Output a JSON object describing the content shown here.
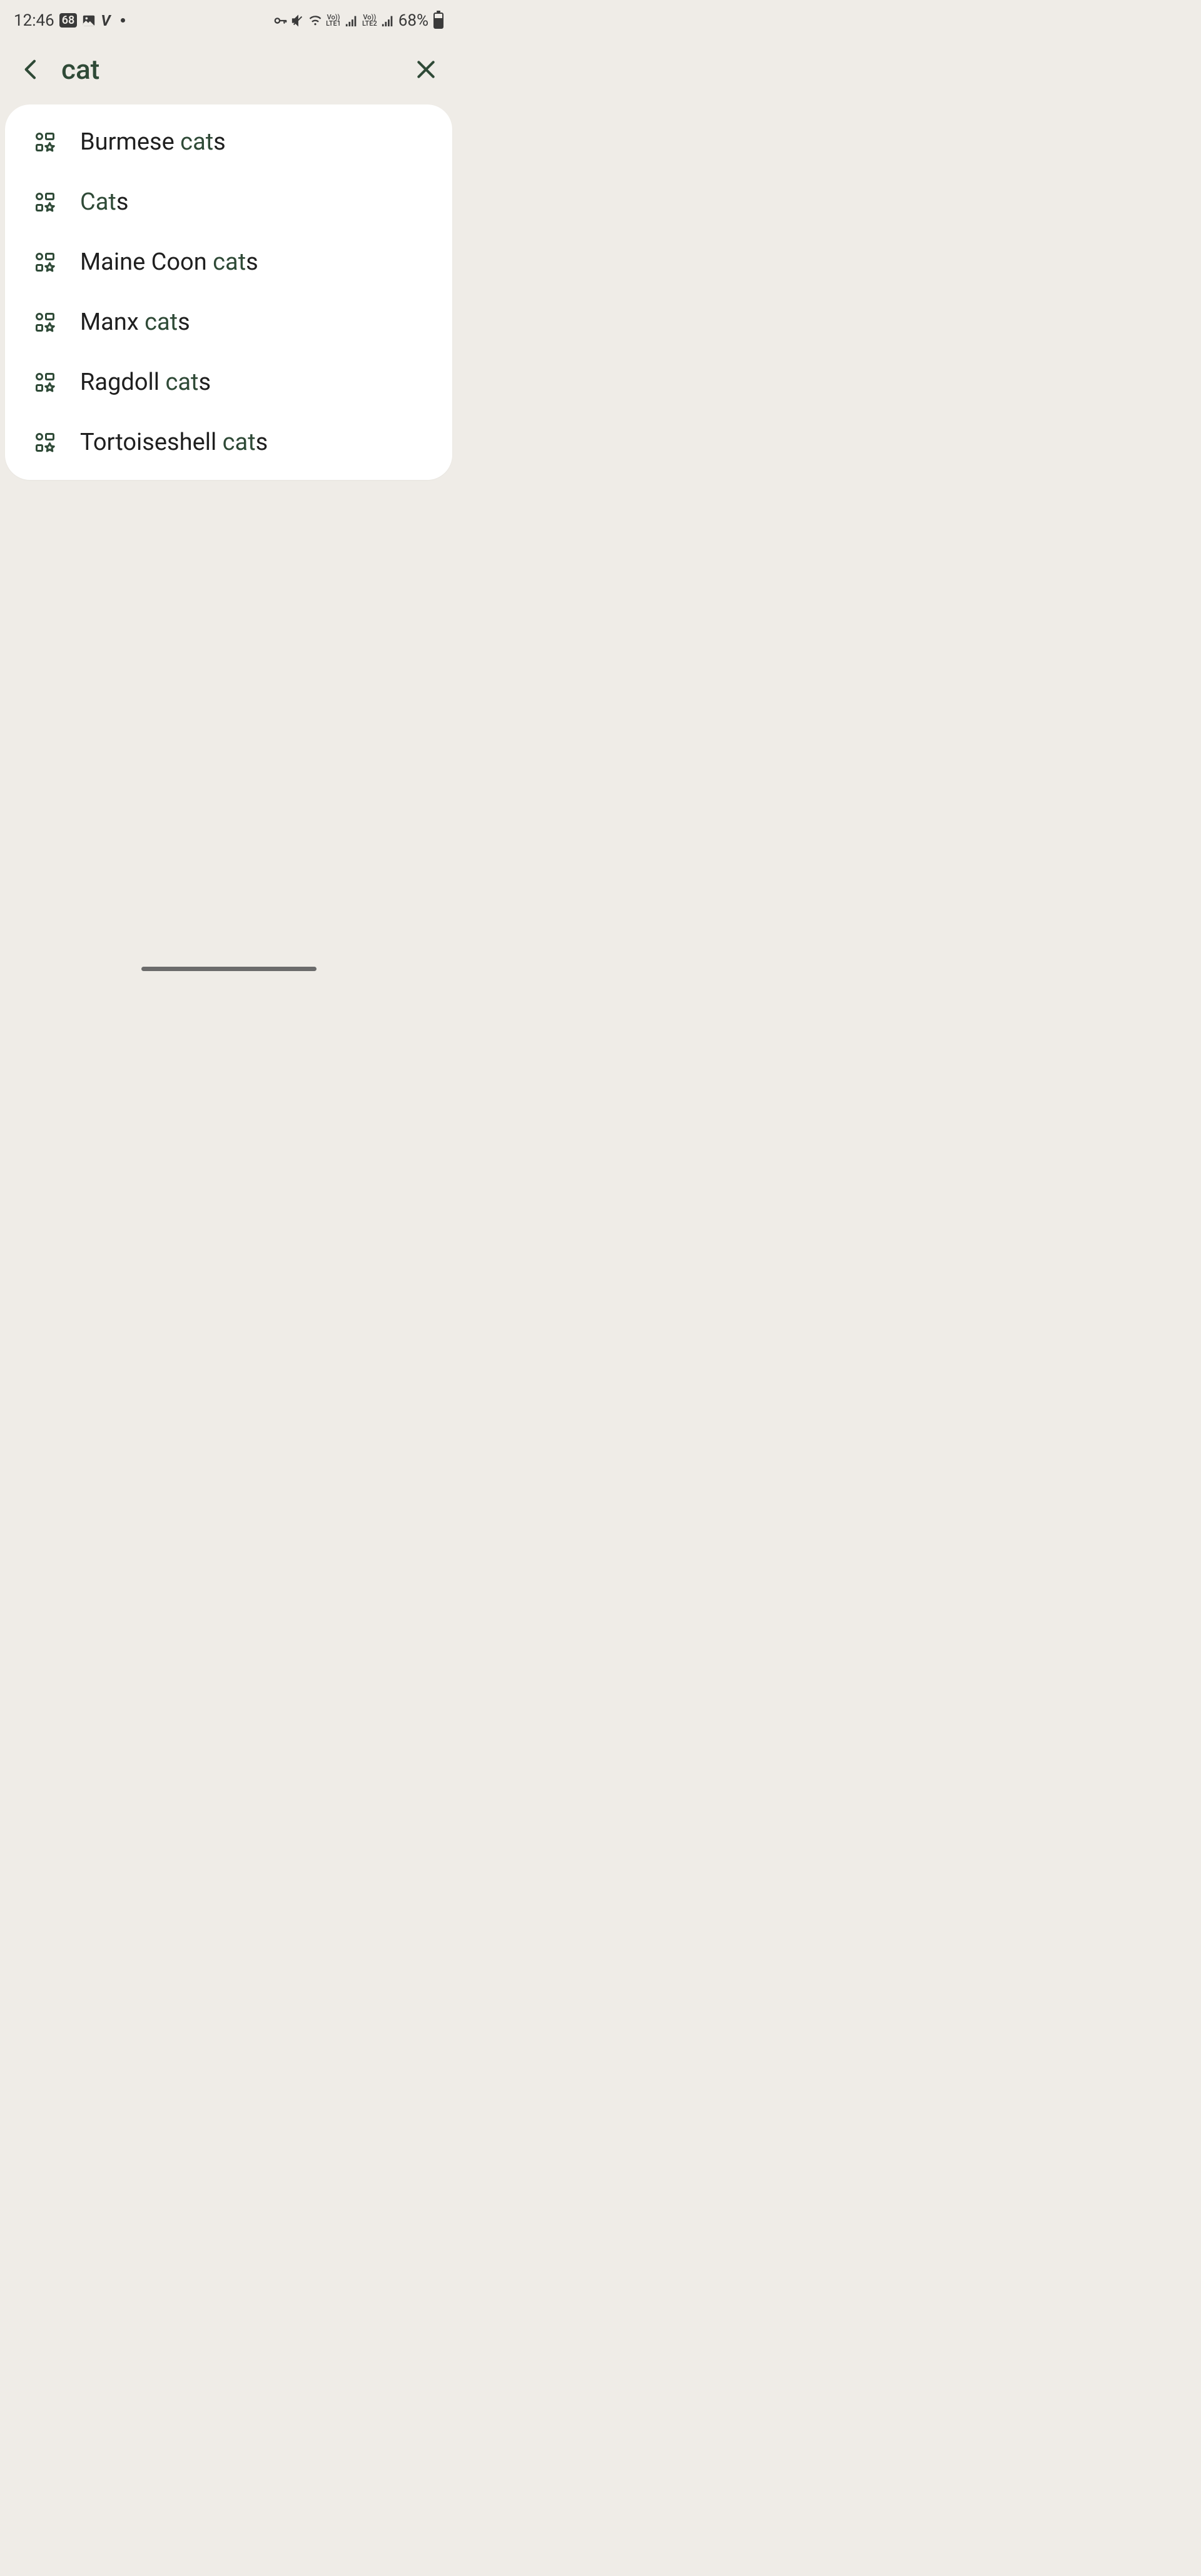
{
  "status": {
    "time": "12:46",
    "notification_count": "68",
    "battery_percent": "68%",
    "lte1_label_top": "Vo))",
    "lte1_label_bot": "LTE1",
    "lte2_label_top": "Vo))",
    "lte2_label_bot": "LTE2"
  },
  "search": {
    "query": "cat"
  },
  "results": [
    {
      "prefix": "Burmese ",
      "match": "cat",
      "suffix": "s"
    },
    {
      "prefix": "",
      "match": "Cat",
      "suffix": "s"
    },
    {
      "prefix": "Maine Coon ",
      "match": "cat",
      "suffix": "s"
    },
    {
      "prefix": "Manx ",
      "match": "cat",
      "suffix": "s"
    },
    {
      "prefix": "Ragdoll ",
      "match": "cat",
      "suffix": "s"
    },
    {
      "prefix": "Tortoiseshell ",
      "match": "cat",
      "suffix": "s"
    }
  ]
}
